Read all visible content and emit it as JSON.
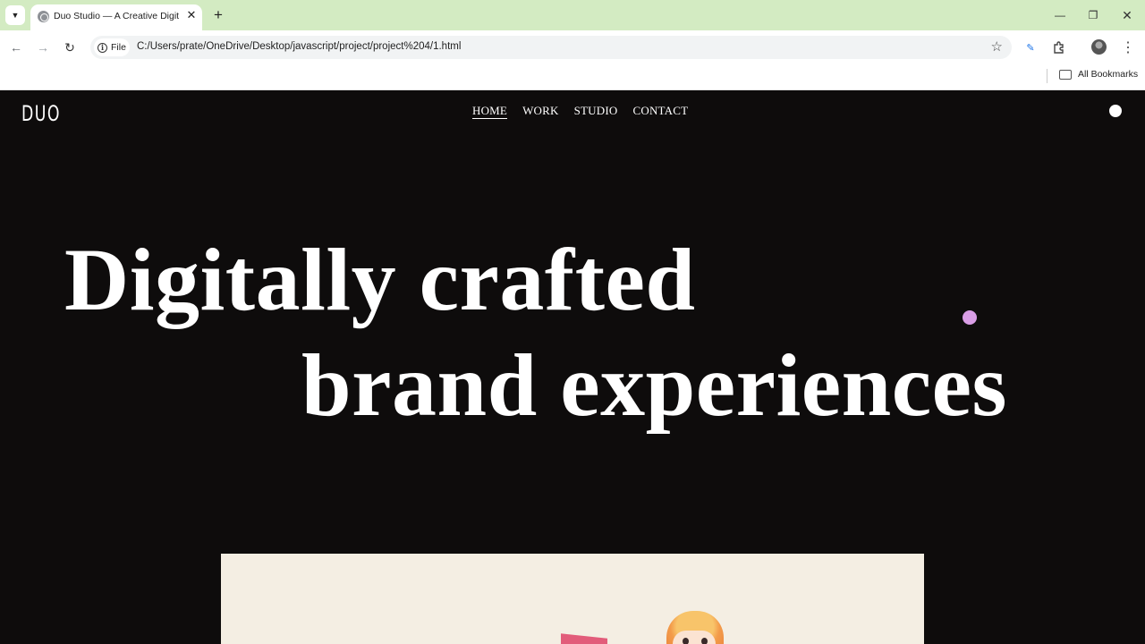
{
  "browser": {
    "tab_title": "Duo Studio — A Creative Digital",
    "new_tab_icon": "plus-icon",
    "site_chip": "File",
    "url": "C:/Users/prate/OneDrive/Desktop/javascript/project/project%204/1.html",
    "bookmarks_label": "All Bookmarks"
  },
  "site": {
    "logo": "DUO",
    "nav": [
      "HOME",
      "WORK",
      "STUDIO",
      "CONTACT"
    ],
    "active_nav": "HOME",
    "hero_line1": "Digitally crafted",
    "hero_line2": "brand experiences",
    "colors": {
      "background": "#0e0c0c",
      "text": "#ffffff",
      "cursor_dot": "#d99ee6",
      "showcase_bg": "#f4eee3"
    }
  }
}
